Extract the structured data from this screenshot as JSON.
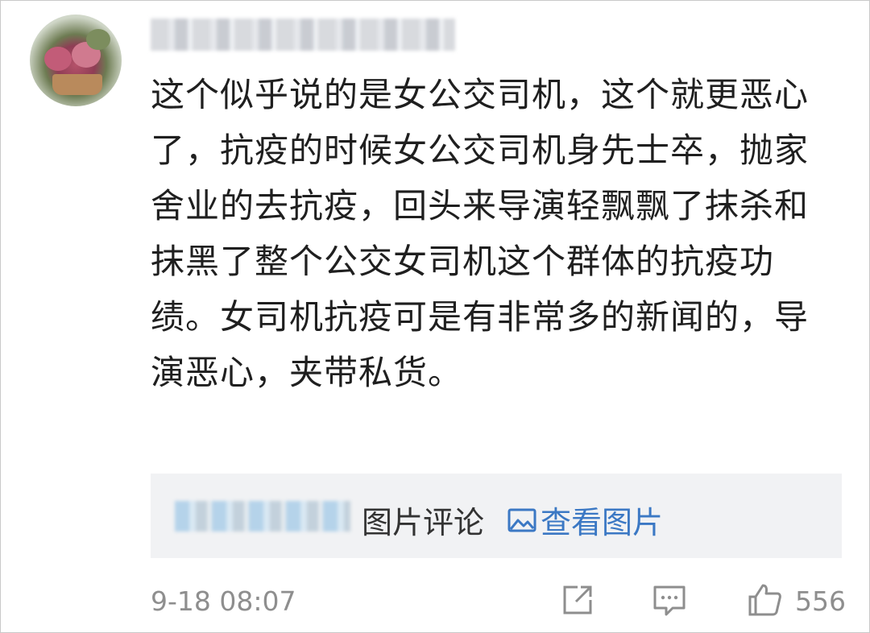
{
  "comment": {
    "username": "",
    "text": "这个似乎说的是女公交司机，这个就更恶心了，抗疫的时候女公交司机身先士卒，抛家舍业的去抗疫，回头来导演轻飘飘了抹杀和抹黑了整个公交女司机这个群体的抗疫功绩。女司机抗疫可是有非常多的新闻的，导演恶心，夹带私货。",
    "quote": {
      "user": "",
      "label": "图片评论",
      "link_label": "查看图片",
      "link_icon": "image-icon"
    },
    "timestamp": "9-18 08:07",
    "actions": {
      "share_icon": "share-icon",
      "reply_icon": "comment-icon",
      "like_icon": "thumbs-up-icon",
      "like_count": "556"
    }
  },
  "colors": {
    "link": "#3b78c4",
    "meta_text": "#8e8e8e",
    "quote_bg": "#f1f2f4"
  }
}
